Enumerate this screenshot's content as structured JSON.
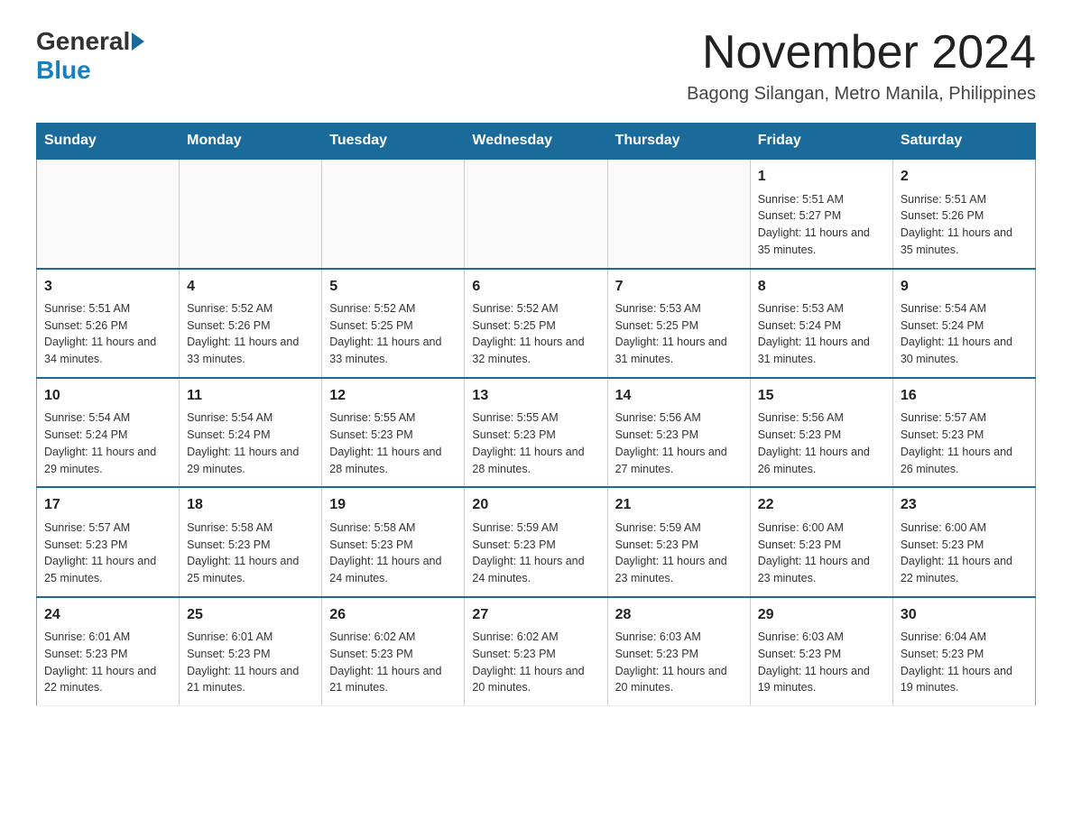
{
  "header": {
    "logo_general": "General",
    "logo_blue": "Blue",
    "month_title": "November 2024",
    "location": "Bagong Silangan, Metro Manila, Philippines"
  },
  "calendar": {
    "days_of_week": [
      "Sunday",
      "Monday",
      "Tuesday",
      "Wednesday",
      "Thursday",
      "Friday",
      "Saturday"
    ],
    "weeks": [
      [
        {
          "day": "",
          "info": ""
        },
        {
          "day": "",
          "info": ""
        },
        {
          "day": "",
          "info": ""
        },
        {
          "day": "",
          "info": ""
        },
        {
          "day": "",
          "info": ""
        },
        {
          "day": "1",
          "info": "Sunrise: 5:51 AM\nSunset: 5:27 PM\nDaylight: 11 hours and 35 minutes."
        },
        {
          "day": "2",
          "info": "Sunrise: 5:51 AM\nSunset: 5:26 PM\nDaylight: 11 hours and 35 minutes."
        }
      ],
      [
        {
          "day": "3",
          "info": "Sunrise: 5:51 AM\nSunset: 5:26 PM\nDaylight: 11 hours and 34 minutes."
        },
        {
          "day": "4",
          "info": "Sunrise: 5:52 AM\nSunset: 5:26 PM\nDaylight: 11 hours and 33 minutes."
        },
        {
          "day": "5",
          "info": "Sunrise: 5:52 AM\nSunset: 5:25 PM\nDaylight: 11 hours and 33 minutes."
        },
        {
          "day": "6",
          "info": "Sunrise: 5:52 AM\nSunset: 5:25 PM\nDaylight: 11 hours and 32 minutes."
        },
        {
          "day": "7",
          "info": "Sunrise: 5:53 AM\nSunset: 5:25 PM\nDaylight: 11 hours and 31 minutes."
        },
        {
          "day": "8",
          "info": "Sunrise: 5:53 AM\nSunset: 5:24 PM\nDaylight: 11 hours and 31 minutes."
        },
        {
          "day": "9",
          "info": "Sunrise: 5:54 AM\nSunset: 5:24 PM\nDaylight: 11 hours and 30 minutes."
        }
      ],
      [
        {
          "day": "10",
          "info": "Sunrise: 5:54 AM\nSunset: 5:24 PM\nDaylight: 11 hours and 29 minutes."
        },
        {
          "day": "11",
          "info": "Sunrise: 5:54 AM\nSunset: 5:24 PM\nDaylight: 11 hours and 29 minutes."
        },
        {
          "day": "12",
          "info": "Sunrise: 5:55 AM\nSunset: 5:23 PM\nDaylight: 11 hours and 28 minutes."
        },
        {
          "day": "13",
          "info": "Sunrise: 5:55 AM\nSunset: 5:23 PM\nDaylight: 11 hours and 28 minutes."
        },
        {
          "day": "14",
          "info": "Sunrise: 5:56 AM\nSunset: 5:23 PM\nDaylight: 11 hours and 27 minutes."
        },
        {
          "day": "15",
          "info": "Sunrise: 5:56 AM\nSunset: 5:23 PM\nDaylight: 11 hours and 26 minutes."
        },
        {
          "day": "16",
          "info": "Sunrise: 5:57 AM\nSunset: 5:23 PM\nDaylight: 11 hours and 26 minutes."
        }
      ],
      [
        {
          "day": "17",
          "info": "Sunrise: 5:57 AM\nSunset: 5:23 PM\nDaylight: 11 hours and 25 minutes."
        },
        {
          "day": "18",
          "info": "Sunrise: 5:58 AM\nSunset: 5:23 PM\nDaylight: 11 hours and 25 minutes."
        },
        {
          "day": "19",
          "info": "Sunrise: 5:58 AM\nSunset: 5:23 PM\nDaylight: 11 hours and 24 minutes."
        },
        {
          "day": "20",
          "info": "Sunrise: 5:59 AM\nSunset: 5:23 PM\nDaylight: 11 hours and 24 minutes."
        },
        {
          "day": "21",
          "info": "Sunrise: 5:59 AM\nSunset: 5:23 PM\nDaylight: 11 hours and 23 minutes."
        },
        {
          "day": "22",
          "info": "Sunrise: 6:00 AM\nSunset: 5:23 PM\nDaylight: 11 hours and 23 minutes."
        },
        {
          "day": "23",
          "info": "Sunrise: 6:00 AM\nSunset: 5:23 PM\nDaylight: 11 hours and 22 minutes."
        }
      ],
      [
        {
          "day": "24",
          "info": "Sunrise: 6:01 AM\nSunset: 5:23 PM\nDaylight: 11 hours and 22 minutes."
        },
        {
          "day": "25",
          "info": "Sunrise: 6:01 AM\nSunset: 5:23 PM\nDaylight: 11 hours and 21 minutes."
        },
        {
          "day": "26",
          "info": "Sunrise: 6:02 AM\nSunset: 5:23 PM\nDaylight: 11 hours and 21 minutes."
        },
        {
          "day": "27",
          "info": "Sunrise: 6:02 AM\nSunset: 5:23 PM\nDaylight: 11 hours and 20 minutes."
        },
        {
          "day": "28",
          "info": "Sunrise: 6:03 AM\nSunset: 5:23 PM\nDaylight: 11 hours and 20 minutes."
        },
        {
          "day": "29",
          "info": "Sunrise: 6:03 AM\nSunset: 5:23 PM\nDaylight: 11 hours and 19 minutes."
        },
        {
          "day": "30",
          "info": "Sunrise: 6:04 AM\nSunset: 5:23 PM\nDaylight: 11 hours and 19 minutes."
        }
      ]
    ]
  }
}
